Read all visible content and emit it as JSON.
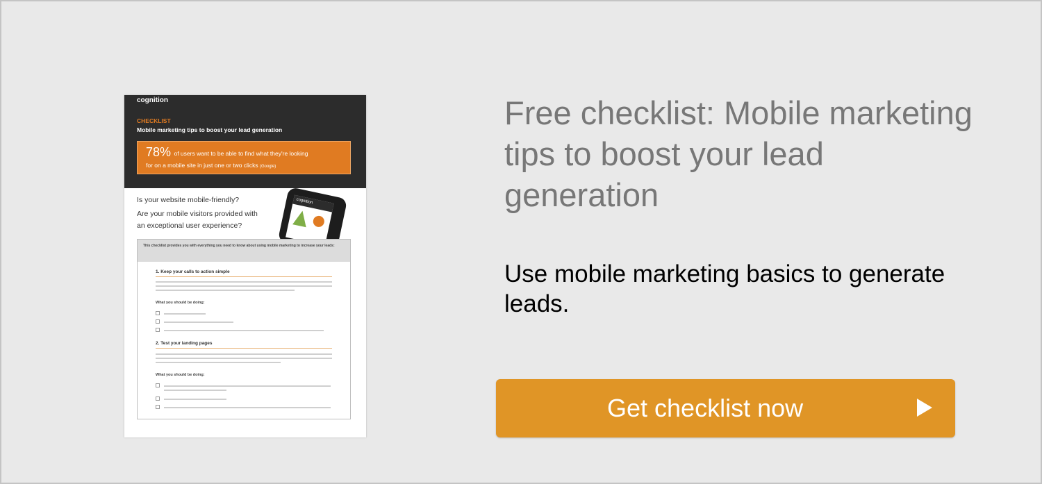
{
  "doc_preview": {
    "logo": "cognition",
    "tag": "CHECKLIST",
    "subtitle": "Mobile marketing tips to boost your lead generation",
    "stat_percent": "78%",
    "stat_text_1": "of users want to be able to find what they're looking",
    "stat_text_2": "for on a mobile site in just one or two clicks",
    "stat_source": "(Google)",
    "question_1": "Is your website mobile-friendly?",
    "question_2": "Are your mobile visitors provided with",
    "question_3": "an exceptional user experience?",
    "intro": "This checklist provides you with everything you need to know about using mobile marketing to increase your leads:",
    "section_1": "1. Keep your calls to action simple",
    "section_2": "2. Test your landing pages",
    "what_to_do": "What you should be doing:"
  },
  "headline": "Free checklist: Mobile marketing tips to boost your lead generation",
  "subheadline": "Use mobile marketing basics to generate leads.",
  "cta": {
    "label": "Get checklist now",
    "icon": "play-arrow-icon",
    "color": "#e09526"
  },
  "colors": {
    "background": "#e9e9e9",
    "headline": "#777777",
    "doc_accent": "#e07b22"
  }
}
